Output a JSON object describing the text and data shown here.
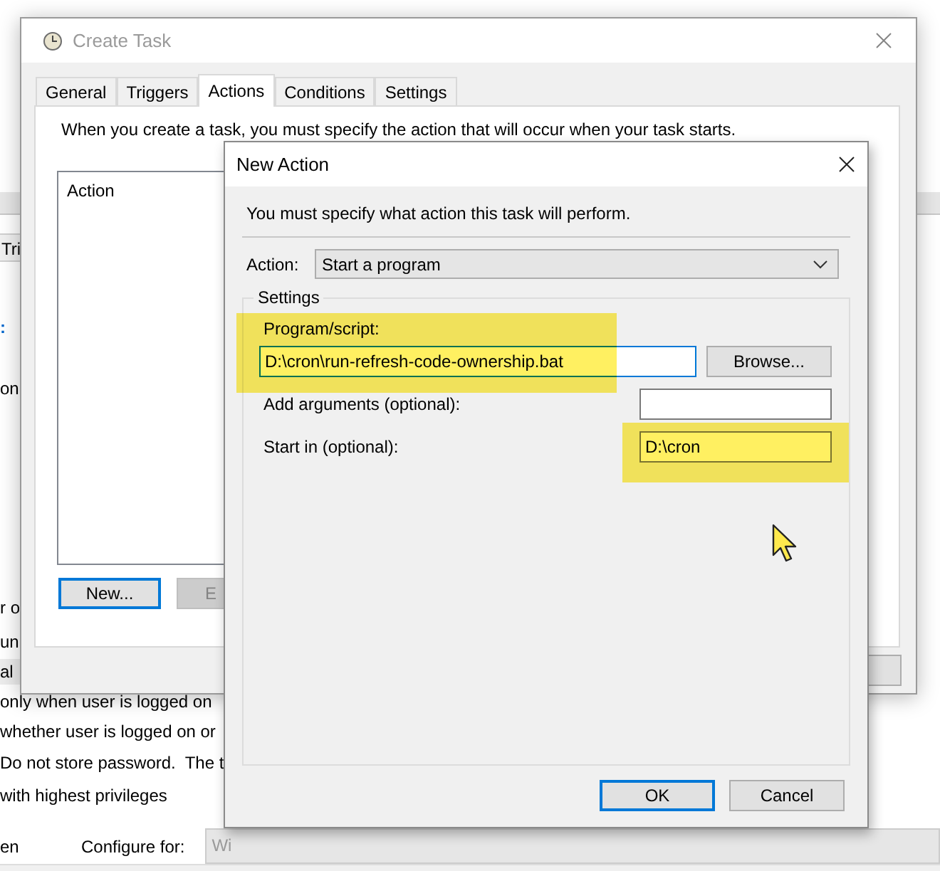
{
  "background_window": {
    "fragments": [
      {
        "text": "Tri",
        "kind": "tab"
      },
      {
        "text": ":",
        "kind": "link"
      },
      {
        "text": "on",
        "kind": "text"
      },
      {
        "text": "r o",
        "kind": "text"
      },
      {
        "text": "un",
        "kind": "text"
      },
      {
        "text": "al",
        "kind": "row"
      },
      {
        "text": "only when user is logged on",
        "kind": "text"
      },
      {
        "text": "whether user is logged on or",
        "kind": "text"
      },
      {
        "text": "Do not store password.  The t",
        "kind": "text"
      },
      {
        "text": "with highest privileges",
        "kind": "text"
      }
    ],
    "footer": {
      "fragment": "en",
      "configure_label": "Configure for:",
      "configure_value": "Wi"
    }
  },
  "create_task": {
    "title": "Create Task",
    "tabs": [
      {
        "label": "General",
        "selected": false
      },
      {
        "label": "Triggers",
        "selected": false
      },
      {
        "label": "Actions",
        "selected": true
      },
      {
        "label": "Conditions",
        "selected": false
      },
      {
        "label": "Settings",
        "selected": false
      }
    ],
    "instruction": "When you create a task, you must specify the action that will occur when your task starts.",
    "list_header": "Action",
    "buttons": [
      {
        "label": "New...",
        "focused": true,
        "disabled": false
      },
      {
        "label": "E",
        "focused": false,
        "disabled": true
      }
    ]
  },
  "new_action": {
    "title": "New Action",
    "instruction": "You must specify what action this task will perform.",
    "action_label": "Action:",
    "action_value": "Start a program",
    "group_label": "Settings",
    "fields": [
      {
        "kind": "stacked",
        "label": "Program/script:",
        "value": "D:\\cron\\run-refresh-code-ownership.bat",
        "highlighted": true,
        "focused": true
      },
      {
        "kind": "inline",
        "label": "Add arguments (optional):",
        "highlighted": false,
        "focused": false
      },
      {
        "kind": "inline",
        "label": "Start in (optional):",
        "value": "D:\\cron",
        "highlighted": true,
        "focused": false
      }
    ],
    "browse": "Browse...",
    "buttons": [
      {
        "label": "OK",
        "focused": true
      },
      {
        "label": "Cancel",
        "focused": false
      }
    ]
  }
}
